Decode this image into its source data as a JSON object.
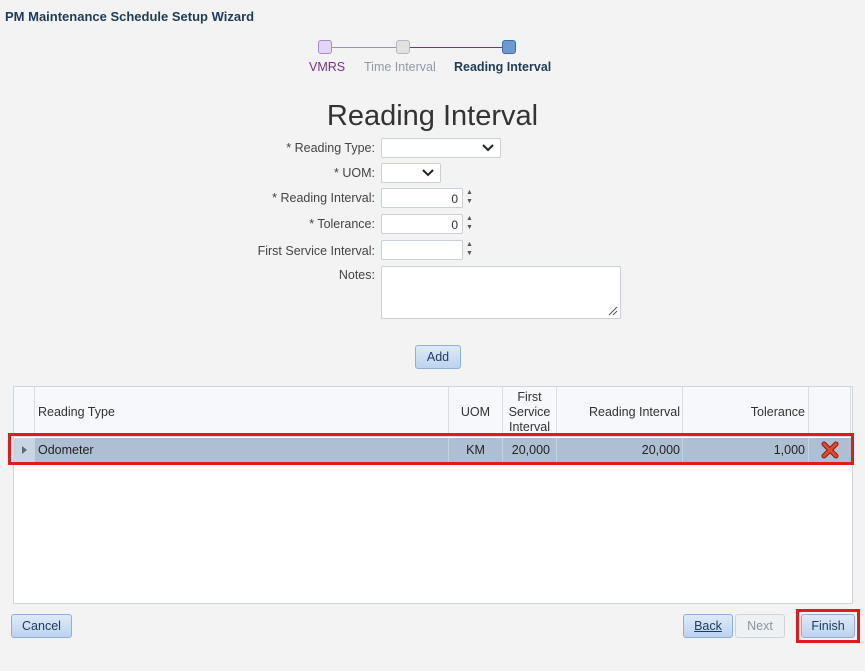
{
  "window": {
    "title": "PM Maintenance Schedule Setup Wizard"
  },
  "wizard": {
    "steps": [
      {
        "label": "VMRS",
        "state": "completed"
      },
      {
        "label": "Time Interval",
        "state": "visited"
      },
      {
        "label": "Reading Interval",
        "state": "current"
      }
    ]
  },
  "form": {
    "heading": "Reading Interval",
    "reading_type": {
      "label": "* Reading Type:",
      "value": ""
    },
    "uom": {
      "label": "* UOM:",
      "value": ""
    },
    "reading_interval": {
      "label": "* Reading Interval:",
      "value": "0"
    },
    "tolerance": {
      "label": "* Tolerance:",
      "value": "0"
    },
    "first_service_interval": {
      "label": "First Service Interval:",
      "value": ""
    },
    "notes": {
      "label": "Notes:",
      "value": ""
    },
    "add_label": "Add"
  },
  "table": {
    "columns": {
      "reading_type": "Reading Type",
      "uom": "UOM",
      "first_service": "First Service Interval",
      "reading_interval": "Reading Interval",
      "tolerance": "Tolerance"
    },
    "rows": [
      {
        "reading_type": "Odometer",
        "uom": "KM",
        "first_service": "20,000",
        "reading_interval": "20,000",
        "tolerance": "1,000"
      }
    ]
  },
  "footer": {
    "cancel": "Cancel",
    "back": "Back",
    "next": "Next",
    "finish": "Finish"
  },
  "colors": {
    "highlight": "#e01b1b",
    "accent": "#1f3b57",
    "step_completed": "#7b2f8a"
  }
}
